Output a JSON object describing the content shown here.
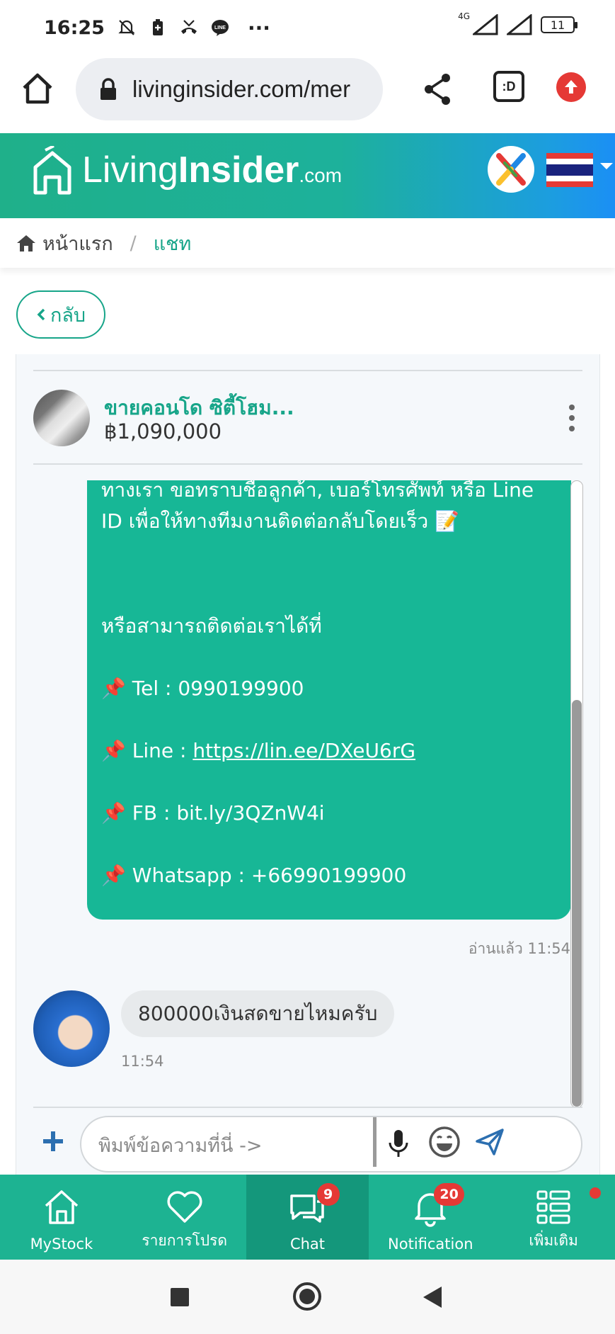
{
  "status_bar": {
    "time": "16:25",
    "more": "···",
    "network": "4G",
    "battery": "11",
    "icons": [
      "mute-icon",
      "battery-saver-icon",
      "missed-call-icon",
      "line-app-icon"
    ]
  },
  "browser": {
    "url": "livinginsider.com/mer",
    "tabs_label": ":D"
  },
  "site": {
    "logo_thin": "Living",
    "logo_bold": "Insider",
    "logo_com": ".com"
  },
  "breadcrumb": {
    "home": "หน้าแรก",
    "separator": "/",
    "current": "แชท"
  },
  "back_label": "กลับ",
  "listing": {
    "title": "ขายคอนโด ซิตี้โฮม...",
    "price": "฿1,090,000"
  },
  "messages": {
    "outgoing": {
      "line1": "ทางเรา ขอทราบชื่อลูกค้า, เบอร์โทรศัพท์ หรือ Line",
      "line2": "ID เพื่อให้ทางทีมงานติดต่อกลับโดยเร็ว 📝",
      "contact_intro": "หรือสามารถติดต่อเราได้ที่",
      "tel": "📌 Tel : 0990199900",
      "line_prefix": "📌 Line : ",
      "line_link": "https://lin.ee/DXeU6rG",
      "fb": "📌 FB : bit.ly/3QZnW4i",
      "whatsapp": "📌 Whatsapp : +66990199900"
    },
    "read_status": "อ่านแล้ว  11:54",
    "incoming": {
      "text": "800000เงินสดขายไหมครับ",
      "time": "11:54"
    }
  },
  "composer": {
    "placeholder": "พิมพ์ข้อความที่นี่ ->"
  },
  "bottom_nav": [
    {
      "label": "MyStock",
      "icon": "home-icon"
    },
    {
      "label": "รายการโปรด",
      "icon": "heart-icon"
    },
    {
      "label": "Chat",
      "icon": "chat-icon",
      "badge": "9",
      "active": true
    },
    {
      "label": "Notification",
      "icon": "bell-icon",
      "badge": "20"
    },
    {
      "label": "เพิ่มเติม",
      "icon": "menu-list-icon",
      "dot": true
    }
  ],
  "colors": {
    "brand_green": "#17b796",
    "nav_green": "#1db392",
    "nav_active": "#14977b",
    "badge_red": "#e53935"
  }
}
